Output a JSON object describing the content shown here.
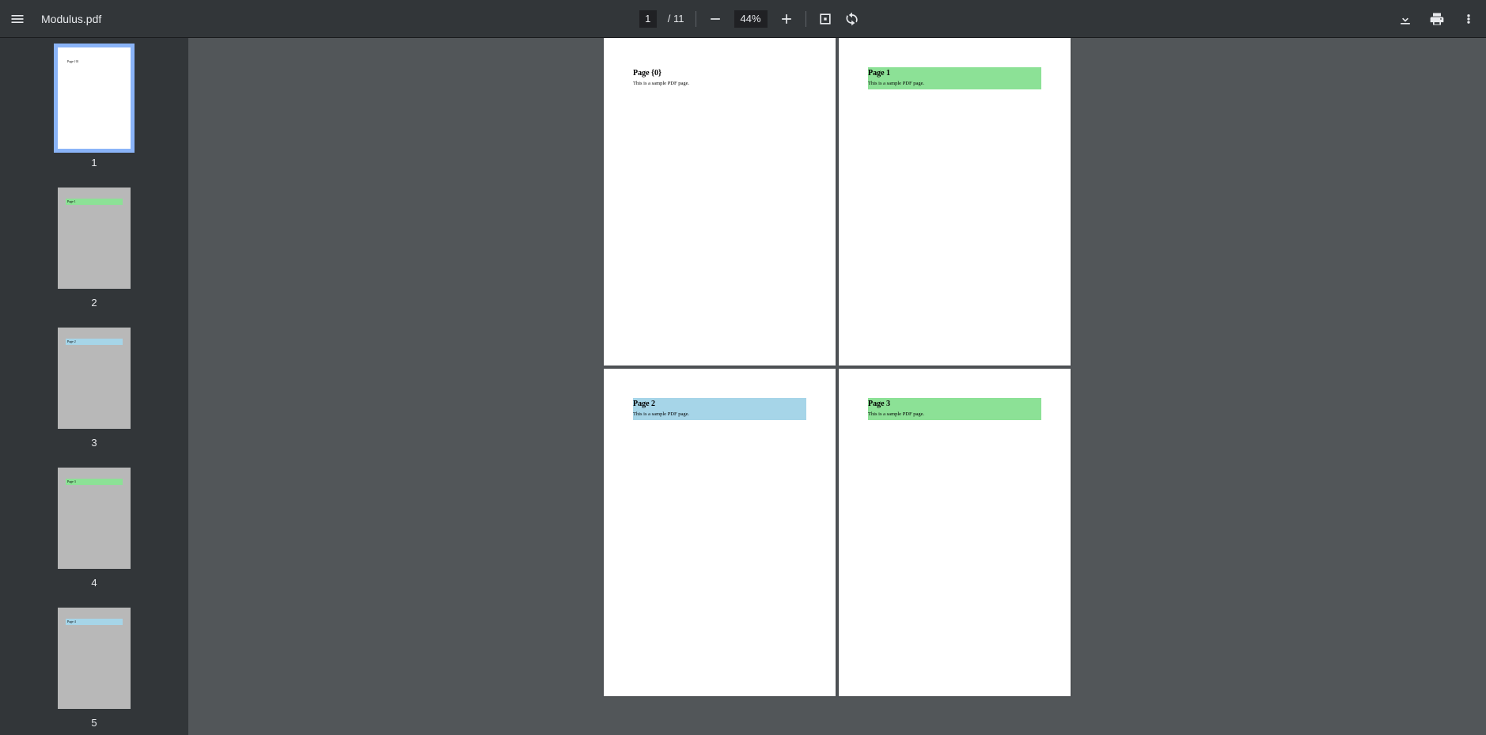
{
  "toolbar": {
    "filename": "Modulus.pdf",
    "current_page": "1",
    "page_total": "/ 11",
    "zoom": "44%"
  },
  "colors": {
    "green": "#8ce196",
    "blue": "#a6d5e8"
  },
  "thumbnails": [
    {
      "label": "1",
      "highlight": "none",
      "selected": true
    },
    {
      "label": "2",
      "highlight": "green",
      "selected": false
    },
    {
      "label": "3",
      "highlight": "blue",
      "selected": false
    },
    {
      "label": "4",
      "highlight": "green",
      "selected": false
    },
    {
      "label": "5",
      "highlight": "blue",
      "selected": false
    }
  ],
  "pages": [
    {
      "title": "Page {0}",
      "body": "This is a sample PDF page.",
      "highlight": "none"
    },
    {
      "title": "Page 1",
      "body": "This is a sample PDF page.",
      "highlight": "green"
    },
    {
      "title": "Page 2",
      "body": "This is a sample PDF page.",
      "highlight": "blue"
    },
    {
      "title": "Page 3",
      "body": "This is a sample PDF page.",
      "highlight": "green"
    }
  ]
}
